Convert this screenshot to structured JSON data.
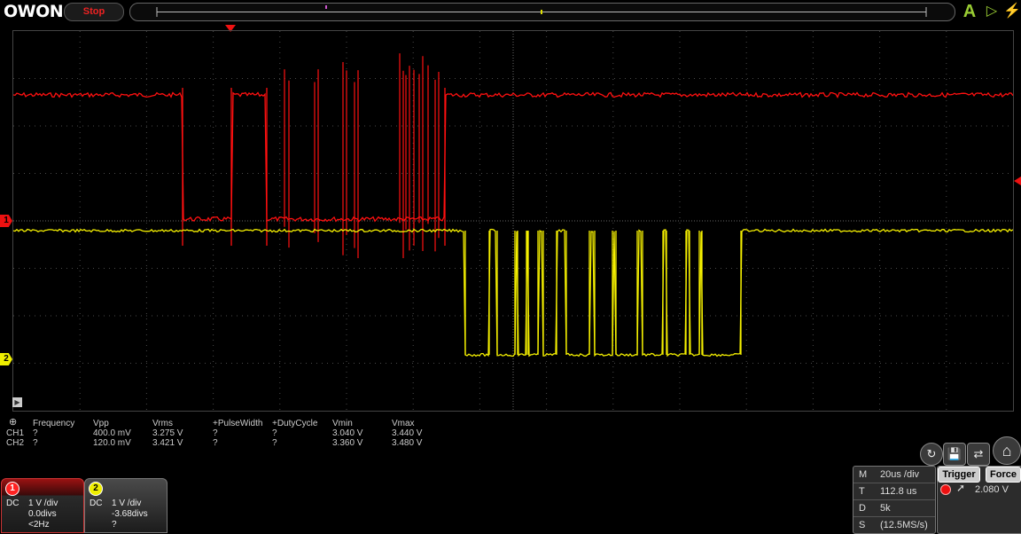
{
  "header": {
    "logo_text": "OWON",
    "run_state": "Stop",
    "auto_label": "A",
    "run_icon": "play-icon",
    "probe_icon": "probe-icon"
  },
  "markers": {
    "ch1": "1",
    "ch2": "2"
  },
  "colors": {
    "ch1": "#ff1010",
    "ch2": "#f5f000",
    "grid": "#4a4a4a",
    "accent": "#99cc33"
  },
  "measurements": {
    "headers": [
      "Frequency",
      "Vpp",
      "Vrms",
      "+PulseWidth",
      "+DutyCycle",
      "Vmin",
      "Vmax"
    ],
    "rows": [
      {
        "label": "CH1",
        "values": [
          "?",
          "400.0 mV",
          "3.275 V",
          "?",
          "?",
          "3.040 V",
          "3.440 V"
        ]
      },
      {
        "label": "CH2",
        "values": [
          "?",
          "120.0 mV",
          "3.421 V",
          "?",
          "?",
          "3.360 V",
          "3.480 V"
        ]
      }
    ]
  },
  "channels": [
    {
      "badge": "1",
      "coupling": "DC",
      "vdiv": "1 V /div",
      "offset": "0.0divs",
      "freq": "<2Hz"
    },
    {
      "badge": "2",
      "coupling": "DC",
      "vdiv": "1 V /div",
      "offset": "-3.68divs",
      "freq": "?"
    }
  ],
  "horizontal": {
    "rows": [
      {
        "key": "M",
        "value": "20us /div"
      },
      {
        "key": "T",
        "value": "112.8 us"
      },
      {
        "key": "D",
        "value": "5k"
      },
      {
        "key": "S",
        "value": "(12.5MS/s)"
      }
    ]
  },
  "trigger": {
    "trigger_label": "Trigger",
    "force_label": "Force",
    "level": "2.080 V",
    "edge_icon": "rising-edge-icon"
  }
}
